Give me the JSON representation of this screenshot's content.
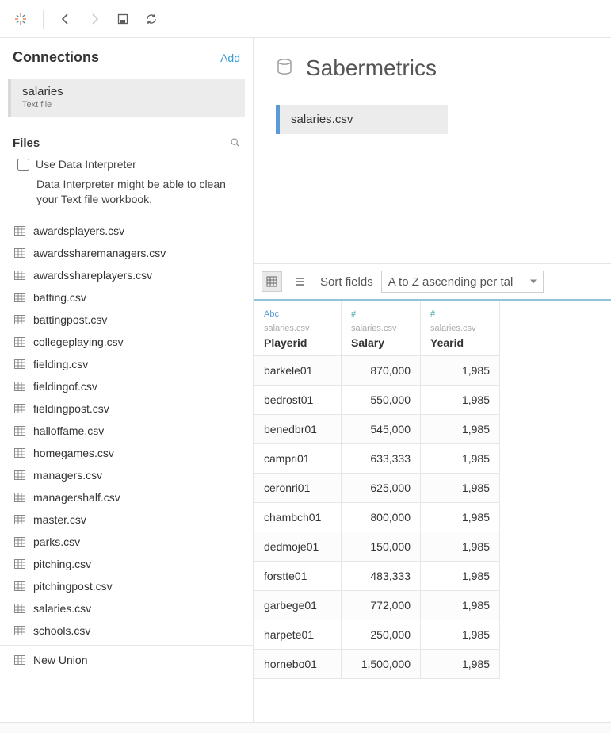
{
  "datasource": {
    "name": "Sabermetrics"
  },
  "sidebar": {
    "heading": "Connections",
    "add_label": "Add",
    "connection": {
      "name": "salaries",
      "type": "Text file"
    },
    "files_heading": "Files",
    "use_interpreter_label": "Use Data Interpreter",
    "interpreter_hint": "Data Interpreter might be able to clean your Text file workbook.",
    "files": [
      "awardsplayers.csv",
      "awardssharemanagers.csv",
      "awardsshareplayers.csv",
      "batting.csv",
      "battingpost.csv",
      "collegeplaying.csv",
      "fielding.csv",
      "fieldingof.csv",
      "fieldingpost.csv",
      "halloffame.csv",
      "homegames.csv",
      "managers.csv",
      "managershalf.csv",
      "master.csv",
      "parks.csv",
      "pitching.csv",
      "pitchingpost.csv",
      "salaries.csv",
      "schools.csv"
    ],
    "new_union_label": "New Union"
  },
  "canvas": {
    "table_pill": "salaries.csv",
    "sort_label": "Sort fields",
    "sort_value": "A to Z ascending per tal"
  },
  "grid": {
    "columns": [
      {
        "type": "Abc",
        "src": "salaries.csv",
        "name": "Playerid",
        "numeric": false
      },
      {
        "type": "#",
        "src": "salaries.csv",
        "name": "Salary",
        "numeric": true
      },
      {
        "type": "#",
        "src": "salaries.csv",
        "name": "Yearid",
        "numeric": true
      }
    ],
    "rows": [
      [
        "barkele01",
        "870,000",
        "1,985"
      ],
      [
        "bedrost01",
        "550,000",
        "1,985"
      ],
      [
        "benedbr01",
        "545,000",
        "1,985"
      ],
      [
        "campri01",
        "633,333",
        "1,985"
      ],
      [
        "ceronri01",
        "625,000",
        "1,985"
      ],
      [
        "chambch01",
        "800,000",
        "1,985"
      ],
      [
        "dedmoje01",
        "150,000",
        "1,985"
      ],
      [
        "forstte01",
        "483,333",
        "1,985"
      ],
      [
        "garbege01",
        "772,000",
        "1,985"
      ],
      [
        "harpete01",
        "250,000",
        "1,985"
      ],
      [
        "hornebo01",
        "1,500,000",
        "1,985"
      ]
    ]
  }
}
